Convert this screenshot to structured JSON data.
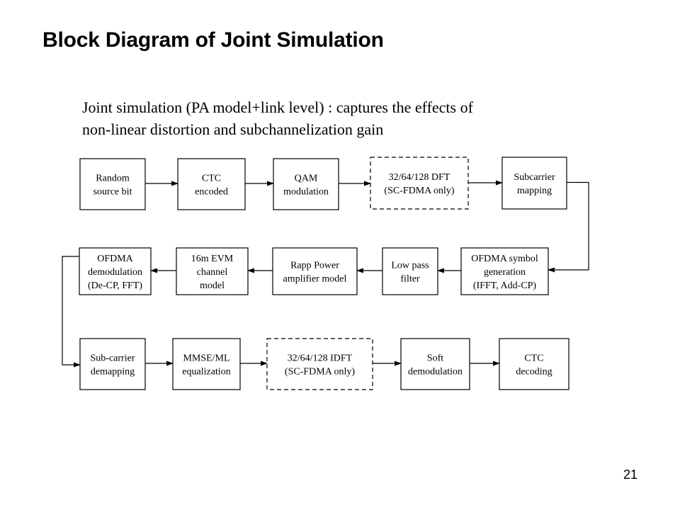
{
  "slide": {
    "title": "Block Diagram of Joint Simulation",
    "subtitle_lines": [
      "Joint simulation (PA model+link level) : captures the effects of",
      "non-linear distortion and subchannelization gain"
    ],
    "page_number": "21"
  },
  "diagram": {
    "blocks": [
      {
        "id": "random-source-bit",
        "lines": [
          "Random",
          "source bit"
        ],
        "style": "solid"
      },
      {
        "id": "ctc-encoded",
        "lines": [
          "CTC",
          "encoded"
        ],
        "style": "solid"
      },
      {
        "id": "qam-modulation",
        "lines": [
          "QAM",
          "modulation"
        ],
        "style": "solid"
      },
      {
        "id": "dft",
        "lines": [
          "32/64/128 DFT",
          "(SC-FDMA only)"
        ],
        "style": "dashed"
      },
      {
        "id": "subcarrier-mapping",
        "lines": [
          "Subcarrier",
          "mapping"
        ],
        "style": "solid"
      },
      {
        "id": "ofdma-symbol-generation",
        "lines": [
          "OFDMA symbol",
          "generation",
          "(IFFT, Add-CP)"
        ],
        "style": "solid"
      },
      {
        "id": "low-pass-filter",
        "lines": [
          "Low pass",
          "filter"
        ],
        "style": "solid"
      },
      {
        "id": "rapp-power-amplifier-model",
        "lines": [
          "Rapp Power",
          "amplifier model"
        ],
        "style": "solid"
      },
      {
        "id": "16m-evm-channel-model",
        "lines": [
          "16m EVM",
          "channel",
          "model"
        ],
        "style": "solid"
      },
      {
        "id": "ofdma-demodulation",
        "lines": [
          "OFDMA",
          "demodulation",
          "(De-CP, FFT)"
        ],
        "style": "solid"
      },
      {
        "id": "sub-carrier-demapping",
        "lines": [
          "Sub-carrier",
          "demapping"
        ],
        "style": "solid"
      },
      {
        "id": "mmse-ml-equalization",
        "lines": [
          "MMSE/ML",
          "equalization"
        ],
        "style": "solid"
      },
      {
        "id": "idft",
        "lines": [
          "32/64/128 IDFT",
          "(SC-FDMA only)"
        ],
        "style": "dashed"
      },
      {
        "id": "soft-demodulation",
        "lines": [
          "Soft",
          "demodulation"
        ],
        "style": "solid"
      },
      {
        "id": "ctc-decoding",
        "lines": [
          "CTC",
          "decoding"
        ],
        "style": "solid"
      }
    ],
    "edges": [
      [
        "random-source-bit",
        "ctc-encoded"
      ],
      [
        "ctc-encoded",
        "qam-modulation"
      ],
      [
        "qam-modulation",
        "dft"
      ],
      [
        "dft",
        "subcarrier-mapping"
      ],
      [
        "subcarrier-mapping",
        "ofdma-symbol-generation"
      ],
      [
        "ofdma-symbol-generation",
        "low-pass-filter"
      ],
      [
        "low-pass-filter",
        "rapp-power-amplifier-model"
      ],
      [
        "rapp-power-amplifier-model",
        "16m-evm-channel-model"
      ],
      [
        "16m-evm-channel-model",
        "ofdma-demodulation"
      ],
      [
        "ofdma-demodulation",
        "sub-carrier-demapping"
      ],
      [
        "sub-carrier-demapping",
        "mmse-ml-equalization"
      ],
      [
        "mmse-ml-equalization",
        "idft"
      ],
      [
        "idft",
        "soft-demodulation"
      ],
      [
        "soft-demodulation",
        "ctc-decoding"
      ]
    ]
  }
}
